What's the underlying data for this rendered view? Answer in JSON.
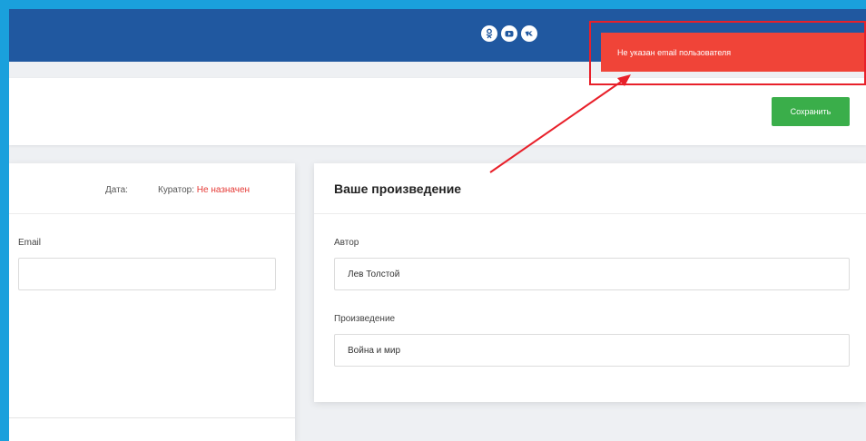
{
  "social": {
    "icons": [
      "odnoklassniki-icon",
      "youtube-icon",
      "vk-icon"
    ]
  },
  "toolbar": {
    "save_label": "Сохранить"
  },
  "left_card": {
    "date_label": "Дата:",
    "curator_label": "Куратор:",
    "curator_value": "Не назначен",
    "email_label": "Email",
    "email_value": ""
  },
  "right_card": {
    "title": "Ваше произведение",
    "author_label": "Автор",
    "author_value": "Лев Толстой",
    "work_label": "Произведение",
    "work_value": "Война и мир"
  },
  "notification": {
    "message": "Не указан email пользователя"
  },
  "colors": {
    "screen_border": "#1aa0dc",
    "header": "#2058a0",
    "save_button": "#3aae4a",
    "toast": "#f04438",
    "annotation": "#e8202a",
    "curator_unassigned": "#e53935"
  }
}
